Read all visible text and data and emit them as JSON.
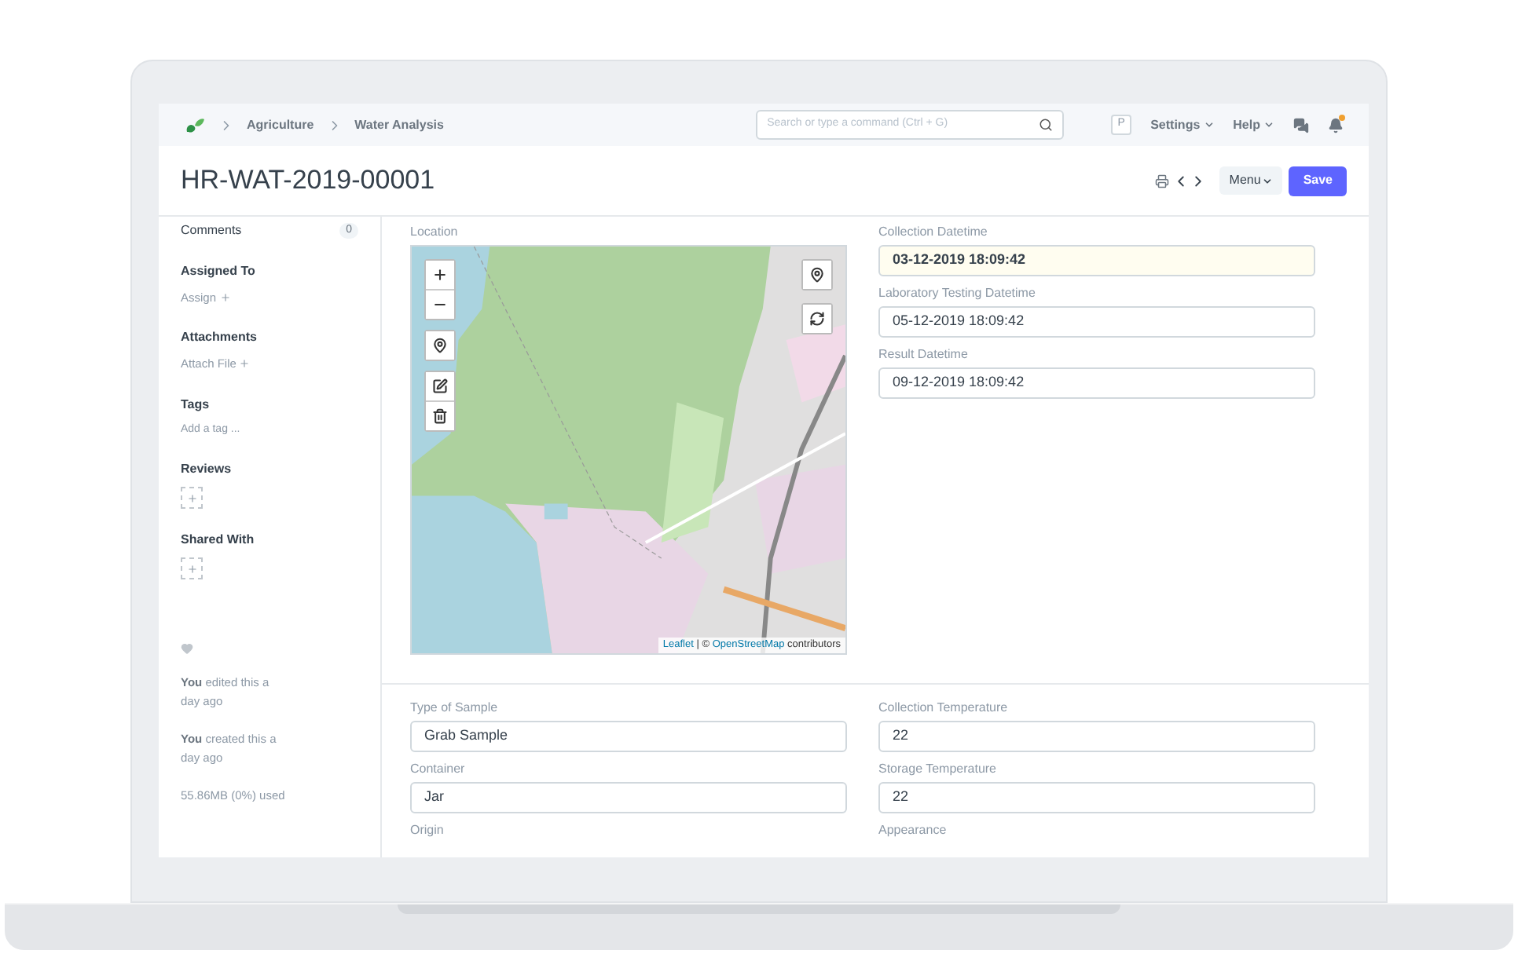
{
  "navbar": {
    "breadcrumbs": [
      "Agriculture",
      "Water Analysis"
    ],
    "search": {
      "placeholder": "Search or type a command (Ctrl + G)"
    },
    "avatar": "P",
    "menus": [
      "Settings",
      "Help"
    ],
    "notification": true
  },
  "page": {
    "title": "HR-WAT-2019-00001",
    "menu": "Menu",
    "save": "Save"
  },
  "sidebar": {
    "comments": {
      "label": "Comments",
      "count": "0"
    },
    "sections": [
      {
        "heading": "Assigned To",
        "kind": "link",
        "text": "Assign"
      },
      {
        "heading": "Attachments",
        "kind": "link",
        "text": "Attach File"
      },
      {
        "heading": "Tags",
        "kind": "tag",
        "text": "Add a tag ..."
      },
      {
        "heading": "Reviews",
        "kind": "add"
      },
      {
        "heading": "Shared With",
        "kind": "add"
      }
    ],
    "activity": [
      {
        "actor": "You",
        "action": "edited this",
        "time": "a day ago"
      },
      {
        "actor": "You",
        "action": "created this",
        "time": "a day ago"
      }
    ],
    "usage": "55.86MB (0%) used"
  },
  "location": {
    "label": "Location",
    "attribution": {
      "link": "Leaflet",
      "separator": "| ©",
      "osm": "OpenStreetMap",
      "tail": "contributors"
    }
  },
  "datetimes": [
    {
      "label": "Collection Datetime",
      "value": "03-12-2019 18:09:42",
      "focused": true
    },
    {
      "label": "Laboratory Testing Datetime",
      "value": "05-12-2019 18:09:42",
      "focused": false
    },
    {
      "label": "Result Datetime",
      "value": "09-12-2019 18:09:42",
      "focused": false
    }
  ],
  "details": {
    "left": [
      {
        "label": "Type of Sample",
        "value": "Grab Sample"
      },
      {
        "label": "Container",
        "value": "Jar"
      },
      {
        "label": "Origin"
      }
    ],
    "right": [
      {
        "label": "Collection Temperature",
        "value": "22"
      },
      {
        "label": "Storage Temperature",
        "value": "22"
      },
      {
        "label": "Appearance"
      }
    ]
  }
}
